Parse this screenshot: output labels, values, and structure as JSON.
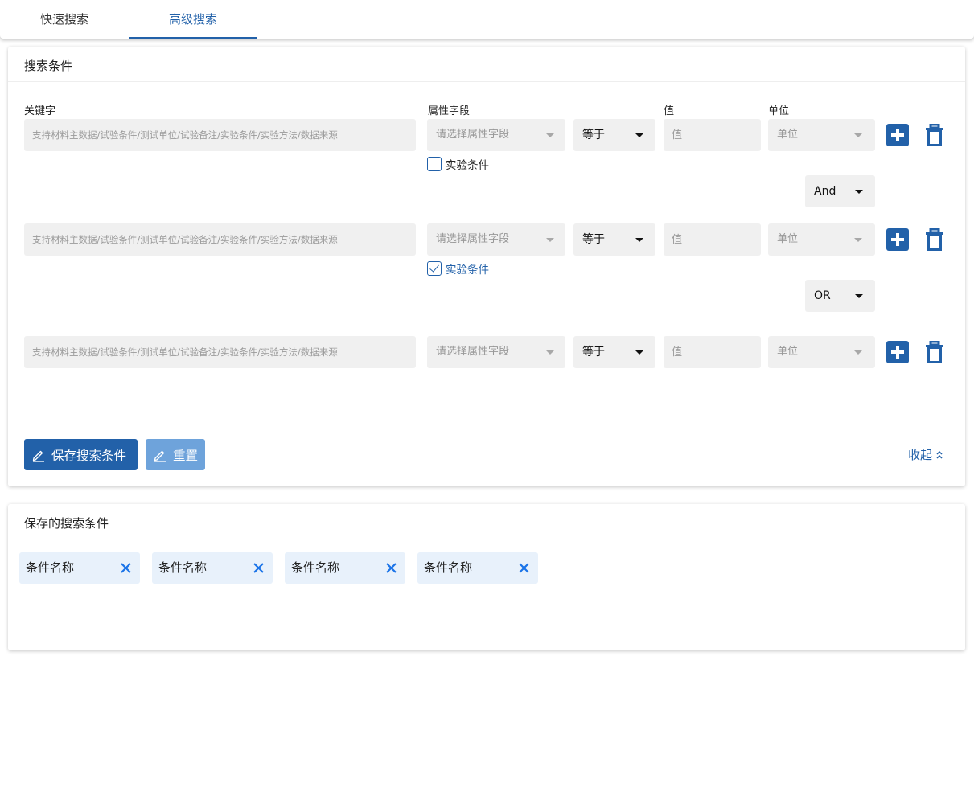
{
  "tabs": [
    {
      "label": "快速搜索",
      "active": false
    },
    {
      "label": "高级搜索",
      "active": true
    }
  ],
  "search_card": {
    "title": "搜索条件",
    "column_labels": {
      "keyword": "关键字",
      "attribute": "属性字段",
      "value": "值",
      "unit": "单位"
    },
    "rows": [
      {
        "keyword_placeholder": "支持材料主数据/试验条件/测试单位/试验备注/实验条件/实验方法/数据来源",
        "attribute_placeholder": "请选择属性字段",
        "operator": "等于",
        "value_placeholder": "值",
        "unit_placeholder": "单位",
        "checkbox_label": "实验条件",
        "checkbox_checked": false,
        "logic_after": "And"
      },
      {
        "keyword_placeholder": "支持材料主数据/试验条件/测试单位/试验备注/实验条件/实验方法/数据来源",
        "attribute_placeholder": "请选择属性字段",
        "operator": "等于",
        "value_placeholder": "值",
        "unit_placeholder": "单位",
        "checkbox_label": "实验条件",
        "checkbox_checked": true,
        "logic_after": "OR"
      },
      {
        "keyword_placeholder": "支持材料主数据/试验条件/测试单位/试验备注/实验条件/实验方法/数据来源",
        "attribute_placeholder": "请选择属性字段",
        "operator": "等于",
        "value_placeholder": "值",
        "unit_placeholder": "单位"
      }
    ],
    "save_button": "保存搜索条件",
    "reset_button": "重置",
    "collapse_link": "收起"
  },
  "saved_card": {
    "title": "保存的搜索条件",
    "chips": [
      "条件名称",
      "条件名称",
      "条件名称",
      "条件名称"
    ]
  },
  "colors": {
    "primary": "#2261a9",
    "primary_light": "#6ea3db",
    "field_bg": "#f0f0f0",
    "chip_bg": "#e8f1fb",
    "chip_close": "#1a73e8"
  },
  "icons": {
    "add": "plus-square-icon",
    "delete": "trash-icon",
    "edit": "pencil-icon",
    "collapse": "chevron-double-up-icon",
    "remove_chip": "close-icon",
    "dropdown": "caret-down-icon"
  }
}
